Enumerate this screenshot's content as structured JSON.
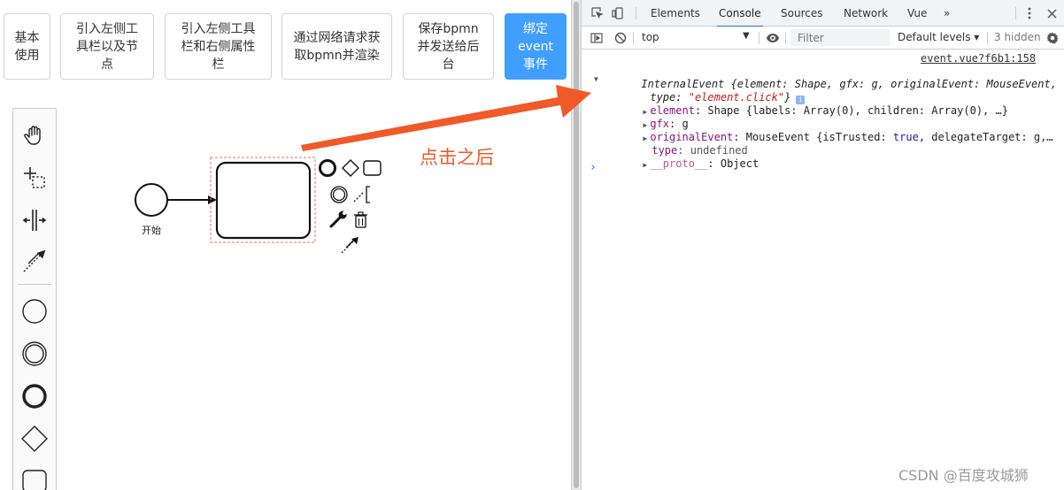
{
  "toolbar_buttons": [
    {
      "line1": "基本",
      "line2": "使用",
      "line3": ""
    },
    {
      "line1": "引入左侧工",
      "line2": "具栏以及节",
      "line3": "点"
    },
    {
      "line1": "引入左侧工具",
      "line2": "栏和右侧属性",
      "line3": "栏"
    },
    {
      "line1": "通过网络请求获",
      "line2": "取bpmn并渲染",
      "line3": ""
    },
    {
      "line1": "保存bpmn",
      "line2": "并发送给后",
      "line3": "台"
    },
    {
      "line1": "绑定",
      "line2": "event",
      "line3": "事件"
    }
  ],
  "palette_tools": [
    {
      "name": "hand-tool-icon"
    },
    {
      "name": "lasso-tool-icon"
    },
    {
      "name": "space-tool-icon"
    },
    {
      "name": "global-connect-tool-icon"
    },
    {
      "name": "start-event-icon"
    },
    {
      "name": "intermediate-event-icon"
    },
    {
      "name": "end-event-icon"
    },
    {
      "name": "gateway-icon"
    },
    {
      "name": "task-icon"
    }
  ],
  "diagram": {
    "start_label": "开始"
  },
  "annotation": {
    "text": "点击之后",
    "color": "#f05a28"
  },
  "devtools": {
    "tabs": [
      "Elements",
      "Console",
      "Sources",
      "Network",
      "Vue"
    ],
    "active_tab": "Console",
    "more_tabs": "»",
    "context": "top",
    "filter_placeholder": "Filter",
    "levels": "Default levels ▾",
    "hidden_count": "3 hidden",
    "source_link": "event.vue?f6b1:158",
    "log": {
      "l1_a": "InternalEvent {element: Shape, gfx: g, originalEvent: MouseEvent,",
      "l2_a": "type: ",
      "l2_b": "\"element.click\"",
      "l2_c": "}",
      "l3_key": "element",
      "l3_val": ": Shape {labels: Array(0), children: Array(0), …}",
      "l4_key": "gfx",
      "l4_val": ": g",
      "l5_key": "originalEvent",
      "l5_val_a": ": MouseEvent {isTrusted: ",
      "l5_val_b": "true",
      "l5_val_c": ", delegateTarget: g,…",
      "l6_key": "type",
      "l6_val": ": undefined",
      "l7_key": "__proto__",
      "l7_val": ": Object"
    },
    "prompt": "›"
  },
  "watermark": "CSDN @百度攻城狮"
}
